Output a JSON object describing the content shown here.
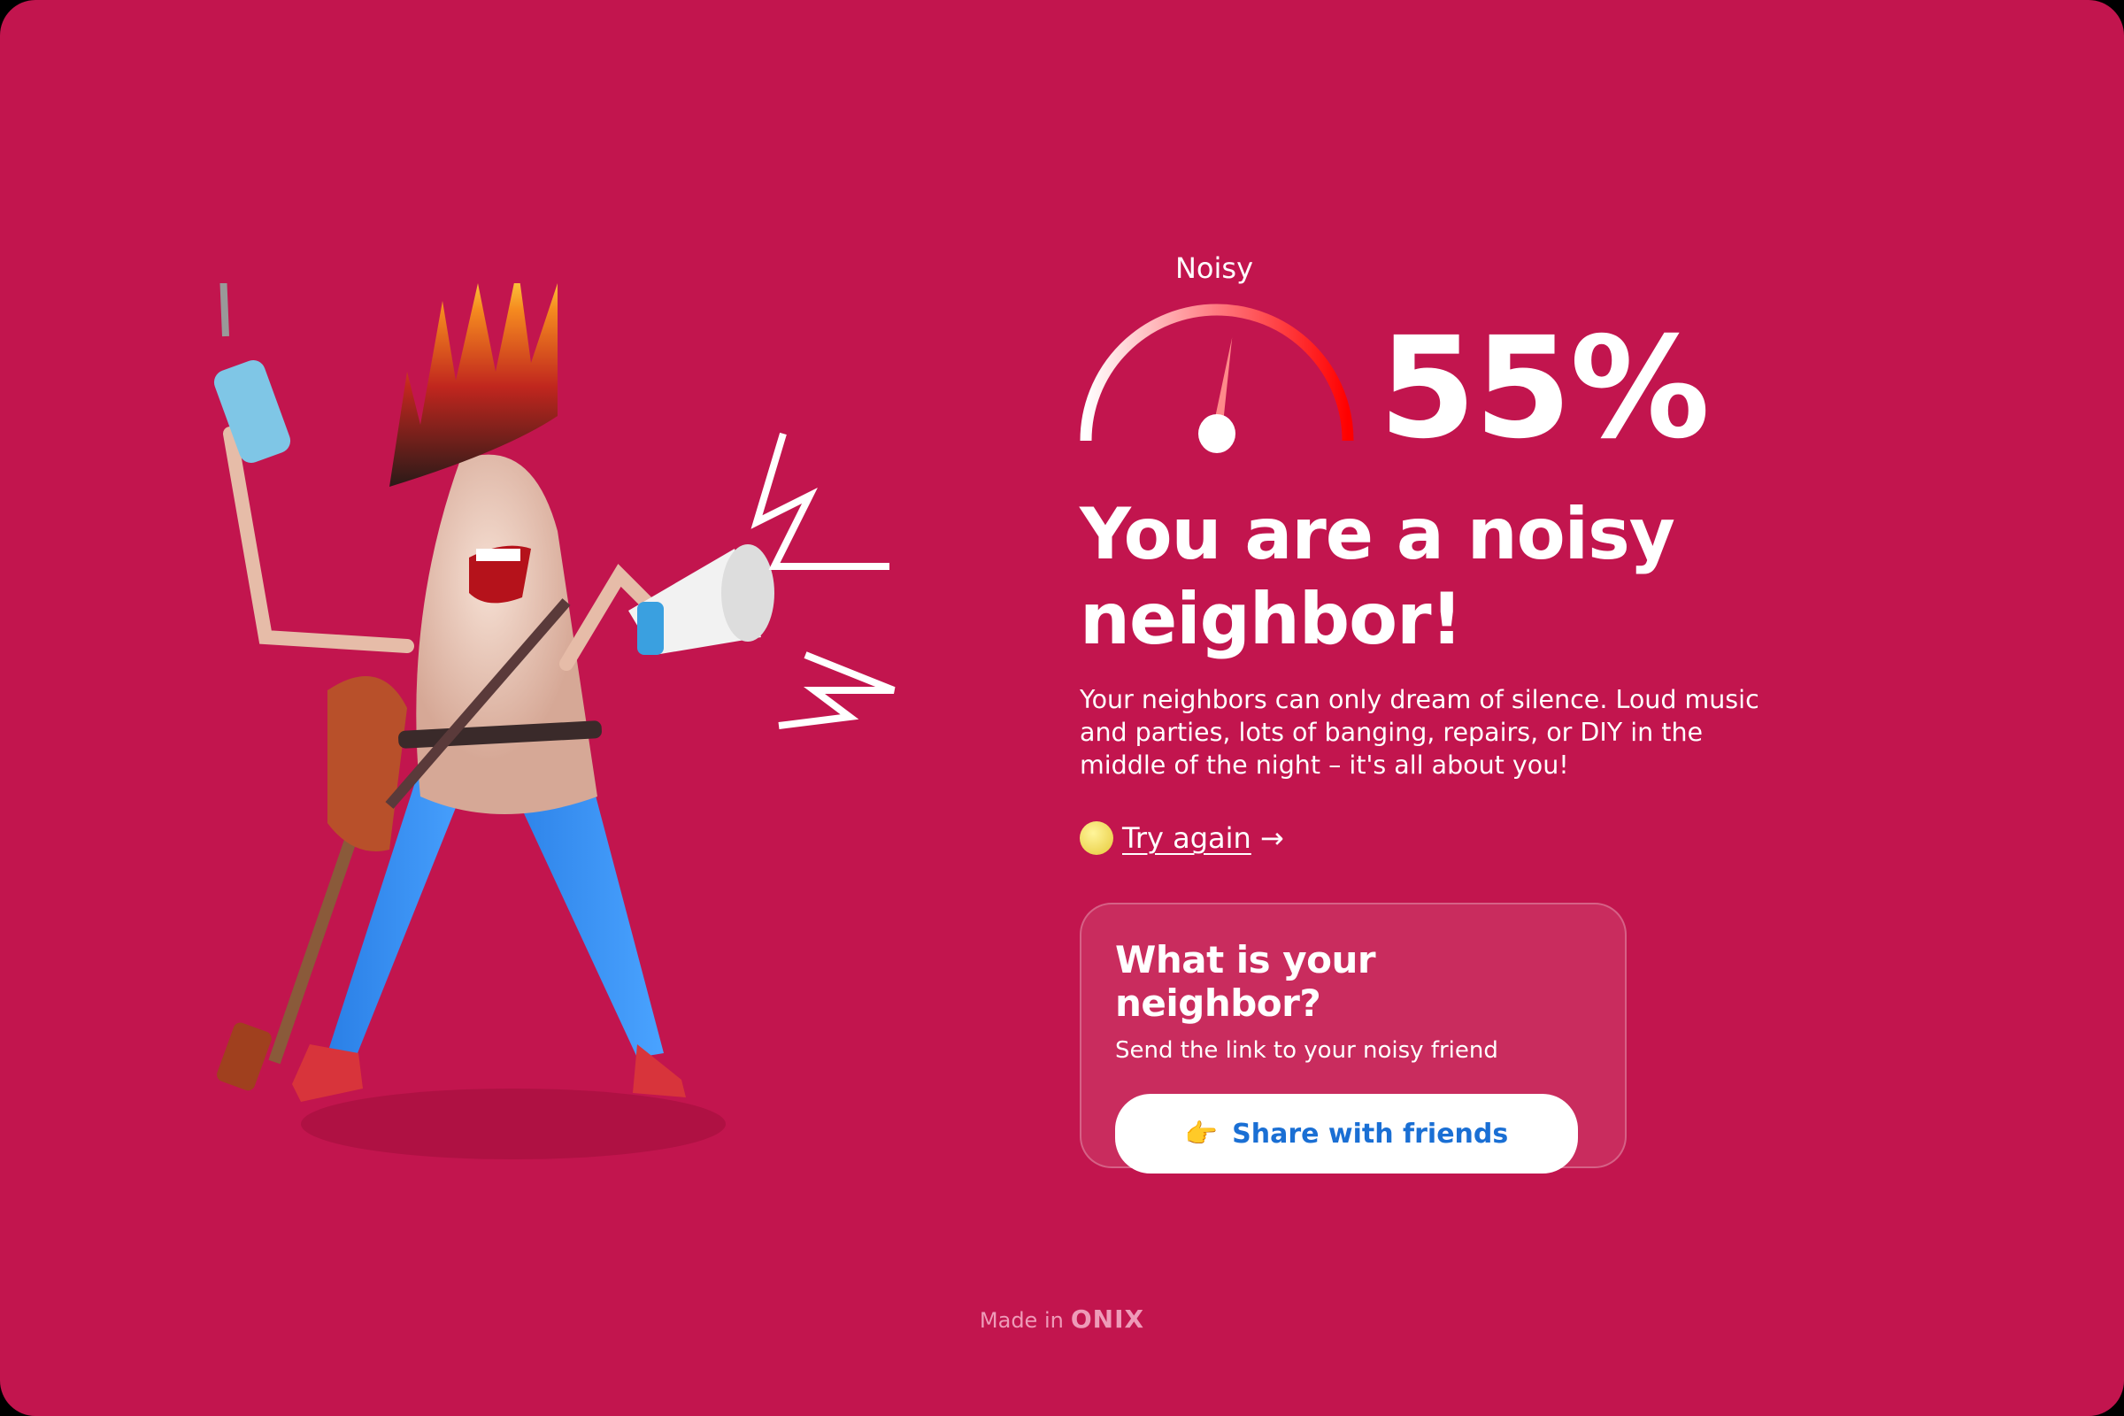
{
  "gauge": {
    "label": "Noisy",
    "value_percent": 55,
    "percent_text": "55%"
  },
  "result": {
    "headline": "You are a noisy neighbor!",
    "description": "Your neighbors can only dream of silence. Loud music and parties, lots of banging, repairs, or DIY in the middle of the night – it's all about you!"
  },
  "try_again": {
    "label": "Try again",
    "arrow": "→",
    "icon": "moon-face-emoji"
  },
  "share_card": {
    "title": "What is your neighbor?",
    "subtitle": "Send the link to your noisy friend",
    "button_label": "Share with friends",
    "button_icon": "👉"
  },
  "footer": {
    "made_in": "Made in",
    "brand": "ONIX"
  },
  "colors": {
    "background": "#C2154E",
    "card": "#C92C5E",
    "button_text": "#1a6fd4",
    "footer": "#EE9BB8"
  }
}
